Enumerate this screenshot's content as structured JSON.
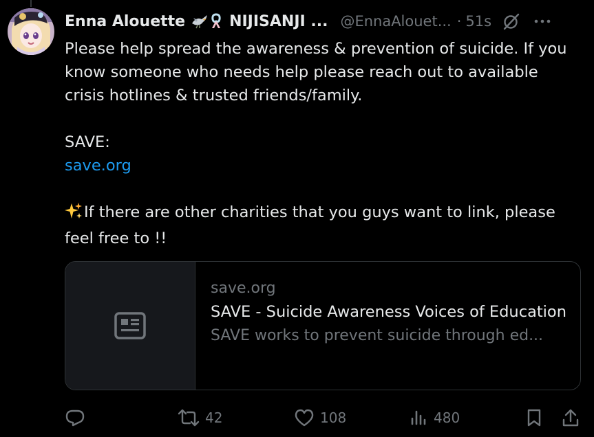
{
  "tweet": {
    "display_name": "Enna Alouette",
    "affiliation": "NIJISANJI ...",
    "handle": "@EnnaAlouet...",
    "separator": "·",
    "time": "51s",
    "body": {
      "line1": "Please help spread the awareness & prevention of suicide. If you know someone who needs help please reach out to available crisis hotlines & trusted friends/family.",
      "save_label": "SAVE:",
      "link": "save.org",
      "charity_text": "If there are other charities that you guys want to link, please feel free to !!"
    },
    "card": {
      "domain": "save.org",
      "title": "SAVE - Suicide Awareness Voices of Education",
      "description": "SAVE works to prevent suicide through ed..."
    },
    "actions": {
      "reply_icon": "reply-icon",
      "retweets": "42",
      "likes": "108",
      "views": "480"
    }
  },
  "colors": {
    "background": "#000000",
    "text_primary": "#e7e9ea",
    "text_secondary": "#71767b",
    "link": "#1d9bf0",
    "border": "#2f3336"
  }
}
